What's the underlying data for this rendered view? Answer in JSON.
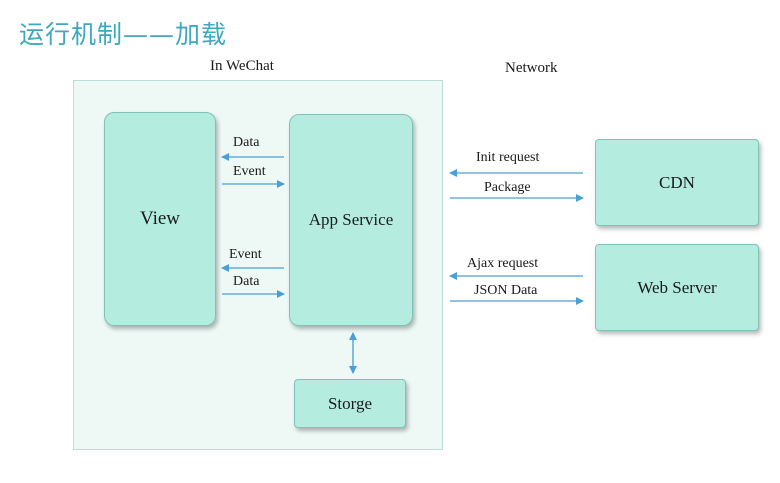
{
  "title": "运行机制——加载",
  "sections": {
    "in_wechat": "In WeChat",
    "network": "Network"
  },
  "boxes": {
    "view": "View",
    "app_service": "App Service",
    "storage": "Storge",
    "cdn": "CDN",
    "web_server": "Web Server"
  },
  "arrows": {
    "app_to_view_data": "Data",
    "view_to_app_event": "Event",
    "app_to_view_event": "Event",
    "view_to_app_data": "Data",
    "init_request": "Init request",
    "package": "Package",
    "ajax_request": "Ajax request",
    "json_data": "JSON Data"
  },
  "colors": {
    "title": "#3fa8bf",
    "box_fill": "#b4ece0",
    "panel_fill": "#eef9f6",
    "arrow": "#4a9fd6"
  }
}
